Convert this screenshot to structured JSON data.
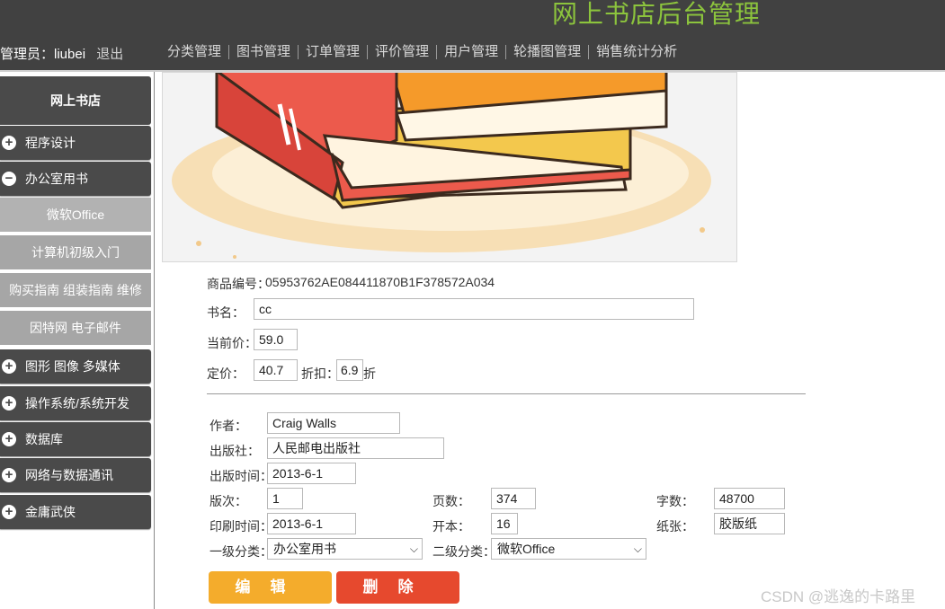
{
  "header": {
    "title": "网上书店后台管理",
    "admin_label": "管理员：liubei",
    "logout": "退出",
    "nav": [
      "分类管理",
      "图书管理",
      "订单管理",
      "评价管理",
      "用户管理",
      "轮播图管理",
      "销售统计分析"
    ]
  },
  "sidebar": {
    "title": "网上书店",
    "cat_programming": "程序设计",
    "cat_office": "办公室用书",
    "sub_office_ms": "微软Office",
    "sub_basic": "计算机初级入门",
    "sub_buying": "购买指南 组装指南 维修",
    "sub_internet": "因特网 电子邮件",
    "cat_graphics": "图形 图像 多媒体",
    "cat_os": "操作系统/系统开发",
    "cat_db": "数据库",
    "cat_network": "网络与数据通讯",
    "cat_wuxia": "金庸武侠"
  },
  "book": {
    "id_label": "商品编号：",
    "id_value": "05953762AE084411870B1F378572A034",
    "name_label": "书名：",
    "name_value": "cc",
    "current_price_label": "当前价：",
    "current_price_value": "59.0",
    "list_price_label": "定价：",
    "list_price_value": "40.7",
    "discount_label": "折扣：",
    "discount_value": "6.9",
    "discount_unit": "折",
    "author_label": "作者：",
    "author_value": "Craig Walls",
    "publisher_label": "出版社：",
    "publisher_value": "人民邮电出版社",
    "pubdate_label": "出版时间：",
    "pubdate_value": "2013-6-1",
    "edition_label": "版次：",
    "edition_value": "1",
    "pages_label": "页数：",
    "pages_value": "374",
    "words_label": "字数：",
    "words_value": "48700",
    "printdate_label": "印刷时间：",
    "printdate_value": "2013-6-1",
    "format_label": "开本：",
    "format_value": "16",
    "paper_label": "纸张：",
    "paper_value": "胶版纸",
    "cat1_label": "一级分类：",
    "cat1_value": "办公室用书",
    "cat2_label": "二级分类：",
    "cat2_value": "微软Office"
  },
  "actions": {
    "edit": "编辑",
    "delete": "删除"
  },
  "watermark": "CSDN @逃逸的卡路里"
}
